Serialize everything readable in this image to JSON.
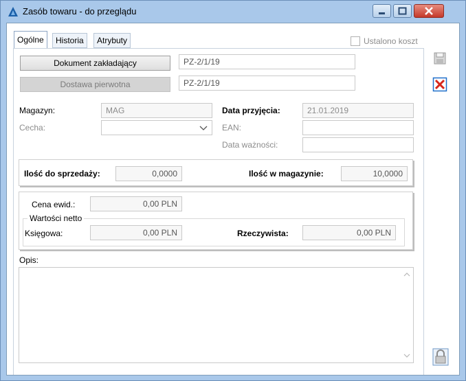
{
  "window": {
    "title": "Zasób towaru - do przeglądu",
    "accent": "#a9c8ea"
  },
  "tabs": [
    {
      "label": "Ogólne",
      "active": true
    },
    {
      "label": "Historia",
      "active": false
    },
    {
      "label": "Atrybuty",
      "active": false
    }
  ],
  "ustalono_koszt": {
    "label": "Ustalono koszt",
    "checked": false
  },
  "buttons": {
    "dokument": "Dokument zakładający",
    "dostawa": "Dostawa pierwotna"
  },
  "docs": {
    "dokument_value": "PZ-2/1/19",
    "dostawa_value": "PZ-2/1/19"
  },
  "form": {
    "magazyn_label": "Magazyn:",
    "magazyn_value": "MAG",
    "cecha_label": "Cecha:",
    "cecha_value": "",
    "data_przyjecia_label": "Data przyjęcia:",
    "data_przyjecia_value": "21.01.2019",
    "ean_label": "EAN:",
    "ean_value": "",
    "data_waznosci_label": "Data ważności:",
    "data_waznosci_value": ""
  },
  "ilosci": {
    "sprzedazy_label": "Ilość do sprzedaży:",
    "sprzedazy_value": "0,0000",
    "magazynie_label": "Ilość w magazynie:",
    "magazynie_value": "10,0000"
  },
  "ceny": {
    "cena_label": "Cena ewid.:",
    "cena_value": "0,00 PLN",
    "group_title": "Wartości netto",
    "ksiegowa_label": "Księgowa:",
    "ksiegowa_value": "0,00 PLN",
    "rzeczywista_label": "Rzeczywista:",
    "rzeczywista_value": "0,00 PLN"
  },
  "opis": {
    "label": "Opis:",
    "value": ""
  },
  "icons": {
    "app": "app-logo-icon",
    "save": "save-icon",
    "cancel": "cancel-icon",
    "lock": "lock-icon",
    "minimize": "minimize-icon",
    "maximize": "maximize-icon",
    "close": "close-icon"
  }
}
